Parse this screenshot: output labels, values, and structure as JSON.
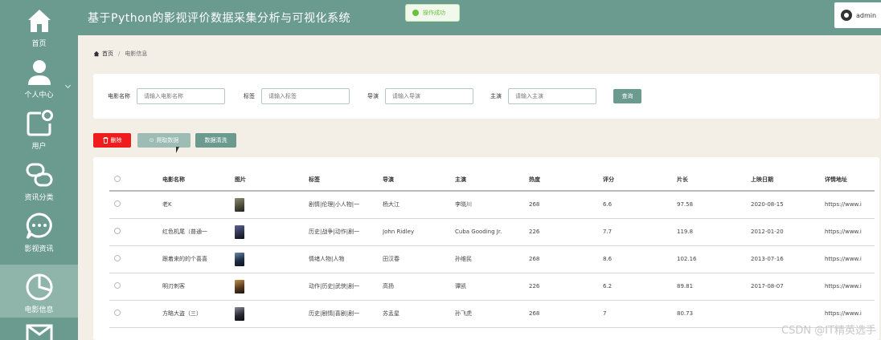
{
  "app": {
    "title": "基于Python的影视评价数据采集分析与可视化系统"
  },
  "toast": {
    "text": "操作成功"
  },
  "user": {
    "name": "admin"
  },
  "sidebar": {
    "items": [
      {
        "label": "首页",
        "icon": "home-icon"
      },
      {
        "label": "个人中心",
        "icon": "person-icon"
      },
      {
        "label": "用户",
        "icon": "user-chat-icon"
      },
      {
        "label": "资讯分类",
        "icon": "link-icon"
      },
      {
        "label": "影视资讯",
        "icon": "chat-bubble-icon"
      },
      {
        "label": "电影信息",
        "icon": "pie-chart-icon",
        "active": true
      },
      {
        "label": "",
        "icon": "mail-icon"
      }
    ]
  },
  "breadcrumb": {
    "home": "首页",
    "current": "电影信息"
  },
  "search": {
    "fields": [
      {
        "label": "电影名称",
        "placeholder": "请输入电影名称"
      },
      {
        "label": "标签",
        "placeholder": "请输入标签"
      },
      {
        "label": "导演",
        "placeholder": "请输入导演"
      },
      {
        "label": "主演",
        "placeholder": "请输入主演"
      }
    ],
    "button": "查询"
  },
  "actions": {
    "delete": "删除",
    "crawl": "爬取数据",
    "clean": "数据清洗"
  },
  "table": {
    "columns": [
      "",
      "电影名称",
      "图片",
      "标签",
      "导演",
      "主演",
      "热度",
      "评分",
      "片长",
      "上映日期",
      "详情地址"
    ],
    "rows": [
      {
        "name": "老K",
        "poster_color": "#4a4a3a",
        "tags": "剧情|伦理|小人物|一",
        "director": "杨大江",
        "actor": "李晓川",
        "heat": "268",
        "score": "6.6",
        "length": "97.58",
        "date": "2020-08-15",
        "url": "https://www.i"
      },
      {
        "name": "红色机尾（普通一",
        "poster_color": "#2a3048",
        "tags": "历史|战争|动作|剧一",
        "director": "John Ridley",
        "actor": "Cuba Gooding Jr.",
        "heat": "226",
        "score": "7.7",
        "length": "119.8",
        "date": "2012-01-20",
        "url": "https://www.i"
      },
      {
        "name": "跟着来的的个喜喜",
        "poster_color": "#1e2e44",
        "tags": "情绪人物|人物",
        "director": "田汉春",
        "actor": "孙维民",
        "heat": "268",
        "score": "8.6",
        "length": "102.16",
        "date": "2013-07-16",
        "url": "https://www.i"
      },
      {
        "name": "明刃刺客",
        "poster_color": "#5a3a22",
        "tags": "动作|历史|武侠|剧一",
        "director": "高扬",
        "actor": "谭凯",
        "heat": "226",
        "score": "6.2",
        "length": "89.81",
        "date": "2017-08-07",
        "url": "https://www.i"
      },
      {
        "name": "方略大盗（三）",
        "poster_color": "#2b2b33",
        "tags": "历史|剧情|喜剧|剧一",
        "director": "苏孟星",
        "actor": "孙飞虎",
        "heat": "268",
        "score": "7",
        "length": "80.73",
        "date": "",
        "url": "https://www.i"
      }
    ]
  },
  "watermark": "CSDN @IT精英选手"
}
